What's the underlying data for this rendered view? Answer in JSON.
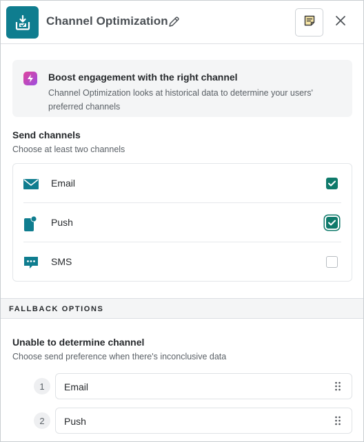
{
  "header": {
    "title": "Channel Optimization",
    "icons": {
      "app": "inbox-download-icon",
      "edit": "pencil-icon",
      "notes": "sticky-note-icon",
      "close": "close-icon"
    },
    "accent_color": "#0f7d8f"
  },
  "info": {
    "title": "Boost engagement with the right channel",
    "text": "Channel Optimization looks at historical data to determine your users' preferred channels",
    "icon": "lightning-bolt-icon"
  },
  "send_channels": {
    "title": "Send channels",
    "subtitle": "Choose at least two channels",
    "channels": [
      {
        "label": "Email",
        "icon": "envelope-icon",
        "checked": true
      },
      {
        "label": "Push",
        "icon": "mobile-push-icon",
        "checked": true
      },
      {
        "label": "SMS",
        "icon": "chat-bubble-icon",
        "checked": false
      }
    ],
    "checked_color": "#0f7a6b"
  },
  "fallback": {
    "section_label": "FALLBACK OPTIONS",
    "title": "Unable to determine channel",
    "subtitle": "Choose send preference when there's inconclusive data",
    "order": [
      {
        "number": "1",
        "label": "Email"
      },
      {
        "number": "2",
        "label": "Push"
      }
    ]
  }
}
